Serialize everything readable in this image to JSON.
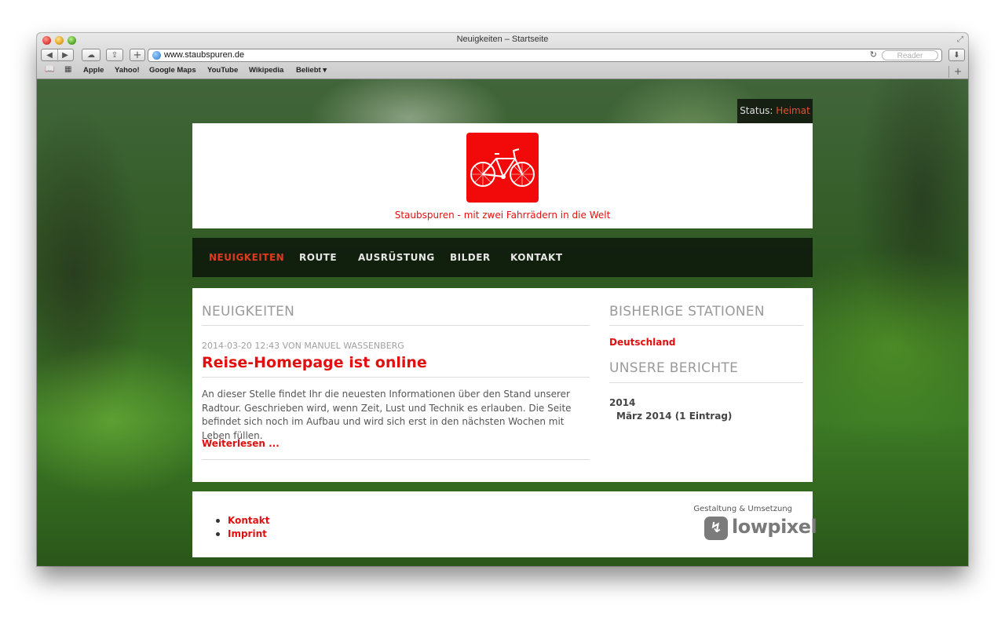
{
  "browser": {
    "window_title": "Neuigkeiten – Startseite",
    "url": "www.staubspuren.de",
    "reader_label": "Reader",
    "bookmarks": [
      "Apple",
      "Yahoo!",
      "Google Maps",
      "YouTube",
      "Wikipedia",
      "Beliebt ▾"
    ],
    "icons": [
      "back-icon",
      "forward-icon",
      "icloud-icon",
      "share-icon",
      "add-bookmark-icon",
      "globe-icon",
      "reload-icon",
      "download-icon",
      "bookmarks-book-icon",
      "top-sites-grid-icon",
      "new-tab-icon"
    ]
  },
  "site": {
    "status_label": "Status:",
    "status_value": "Heimat",
    "tagline": "Staubspuren - mit zwei Fahrrädern in die Welt",
    "logo_icon": "bicycle-icon",
    "accent_color": "#e01010",
    "nav": [
      {
        "label": "NEUIGKEITEN",
        "active": true
      },
      {
        "label": "ROUTE",
        "active": false
      },
      {
        "label": "AUSRÜSTUNG",
        "active": false
      },
      {
        "label": "BILDER",
        "active": false
      },
      {
        "label": "KONTAKT",
        "active": false
      }
    ]
  },
  "main": {
    "section_title": "NEUIGKEITEN",
    "post": {
      "meta": "2014-03-20 12:43 VON MANUEL WASSENBERG",
      "title": "Reise-Homepage ist online",
      "excerpt": "An dieser Stelle findet Ihr die neuesten Informationen über den Stand unserer Radtour. Geschrieben wird, wenn Zeit, Lust und Technik es erlauben. Die Seite befindet sich noch im Aufbau und wird sich erst in den nächsten Wochen mit Leben füllen.",
      "read_more": "Weiterlesen ..."
    }
  },
  "sidebar": {
    "stations_title": "BISHERIGE STATIONEN",
    "stations": [
      "Deutschland"
    ],
    "reports_title": "UNSERE BERICHTE",
    "archive_year": "2014",
    "archive_month": "März 2014 (1 Eintrag)"
  },
  "footer": {
    "links": [
      "Kontakt",
      "Imprint"
    ],
    "credit": "Gestaltung & Umsetzung",
    "brand": "lowpixel"
  }
}
